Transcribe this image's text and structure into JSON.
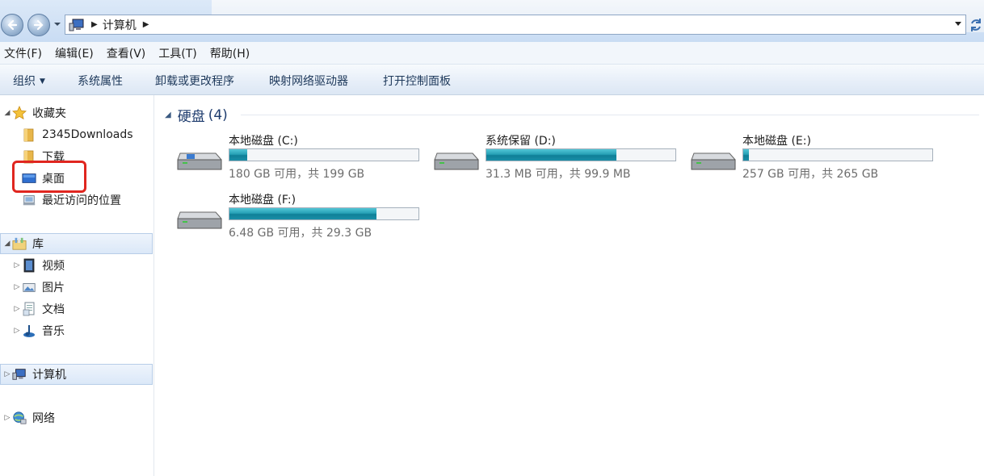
{
  "address": {
    "crumbs": [
      "计算机"
    ]
  },
  "menu": [
    "文件(F)",
    "编辑(E)",
    "查看(V)",
    "工具(T)",
    "帮助(H)"
  ],
  "toolbar": {
    "organize": "组织",
    "system_properties": "系统属性",
    "uninstall": "卸载或更改程序",
    "map_drive": "映射网络驱动器",
    "control_panel": "打开控制面板"
  },
  "nav": {
    "favorites": "收藏夹",
    "fav_items": [
      "2345Downloads",
      "下载",
      "桌面",
      "最近访问的位置"
    ],
    "libraries": "库",
    "lib_items": [
      "视频",
      "图片",
      "文档",
      "音乐"
    ],
    "computer": "计算机",
    "network": "网络"
  },
  "content": {
    "group_title": "硬盘",
    "group_count": "(4)",
    "drives": [
      {
        "name": "本地磁盘 (C:)",
        "free": "180 GB 可用，共 199 GB",
        "used_fraction": 0.096
      },
      {
        "name": "系统保留 (D:)",
        "free": "31.3 MB 可用，共 99.9 MB",
        "used_fraction": 0.687
      },
      {
        "name": "本地磁盘 (E:)",
        "free": "257 GB 可用，共 265 GB",
        "used_fraction": 0.03
      },
      {
        "name": "本地磁盘 (F:)",
        "free": "6.48 GB 可用，共 29.3 GB",
        "used_fraction": 0.779
      }
    ]
  },
  "colors": {
    "highlight": "#e0261f",
    "bar_fill": "#26a0b6",
    "group_title": "#1e3c6e"
  },
  "icons": [
    "back-icon",
    "forward-icon",
    "computer-icon",
    "refresh-icon",
    "star-icon",
    "folder-icon",
    "desktop-icon",
    "recent-places-icon",
    "library-icon",
    "video-icon",
    "pictures-icon",
    "documents-icon",
    "music-icon",
    "network-icon",
    "hard-drive-icon"
  ]
}
